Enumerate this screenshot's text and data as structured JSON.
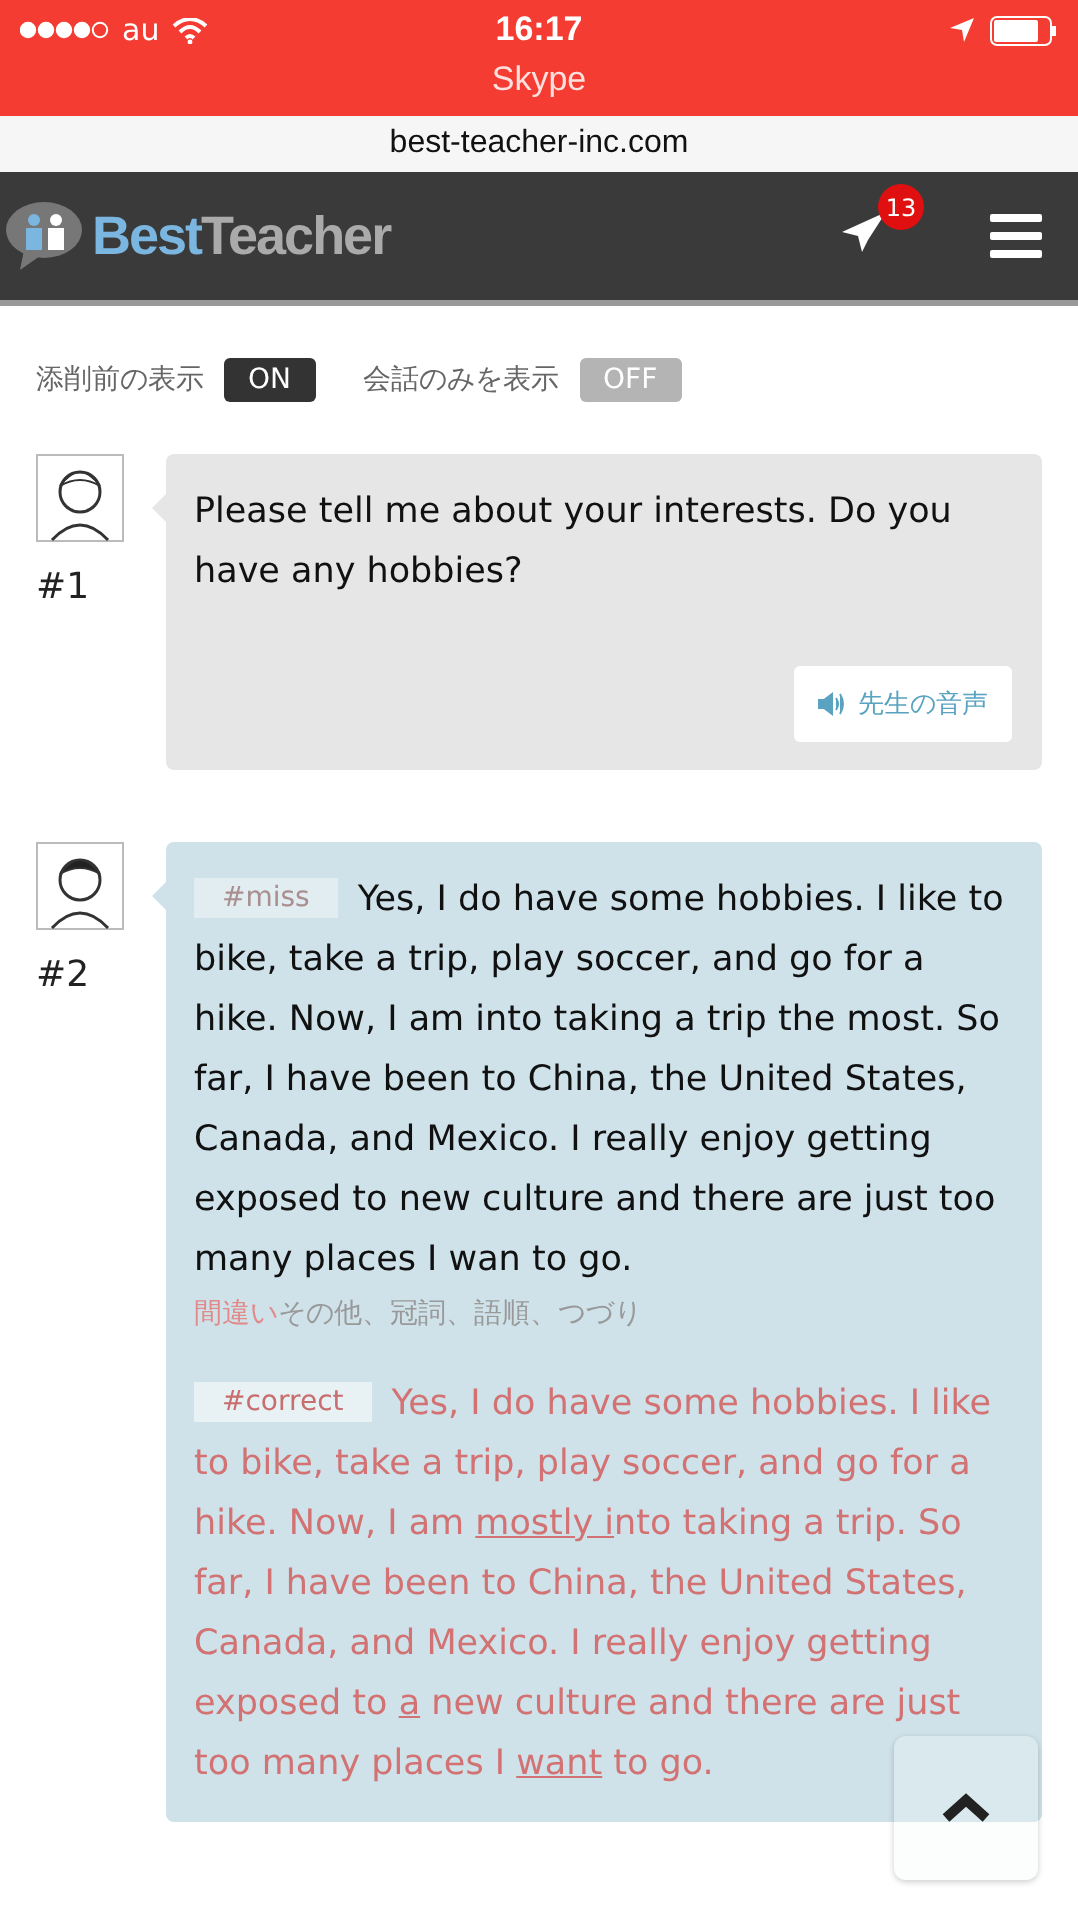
{
  "status_bar": {
    "carrier": "au",
    "time": "16:17"
  },
  "return_bar": {
    "label": "Skype"
  },
  "url_bar": {
    "url": "best-teacher-inc.com"
  },
  "header": {
    "logo_first": "Best",
    "logo_second": "Teacher",
    "badge": "13"
  },
  "toggles": [
    {
      "label": "添削前の表示",
      "value": "ON",
      "on": true
    },
    {
      "label": "会話のみを表示",
      "value": "OFF",
      "on": false
    }
  ],
  "messages": [
    {
      "kind": "teacher",
      "number": "#1",
      "text": "Please tell me about your interests. Do you have any hobbies?",
      "audio_button": "先生の音声"
    },
    {
      "kind": "student",
      "number": "#2",
      "miss_tag": "#miss",
      "text": "Yes, I do have some hobbies. I like to bike, take a trip, play soccer, and go for a hike. Now, I am into taking a trip the most. So far, I have been to China, the United States, Canada, and Mexico. I really enjoy getting exposed to new culture and there are just too many places I wan to go.",
      "miss_label": "間違い",
      "miss_categories": "その他、冠詞、語順、つづり",
      "correct_tag": "#correct",
      "correction": [
        {
          "text": "Yes, I do have some hobbies. I like to bike, take a trip, play soccer, and go for a hike. Now, I am ",
          "underlined": false
        },
        {
          "text": "mostly i",
          "underlined": true
        },
        {
          "text": "nto taking a trip. So far, I have been to China, the United States, Canada, and Mexico. I really enjoy getting exposed to ",
          "underlined": false
        },
        {
          "text": "a",
          "underlined": true
        },
        {
          "text": " new culture and there are just too many places I ",
          "underlined": false
        },
        {
          "text": "want",
          "underlined": true
        },
        {
          "text": " to go.",
          "underlined": false
        }
      ]
    }
  ]
}
